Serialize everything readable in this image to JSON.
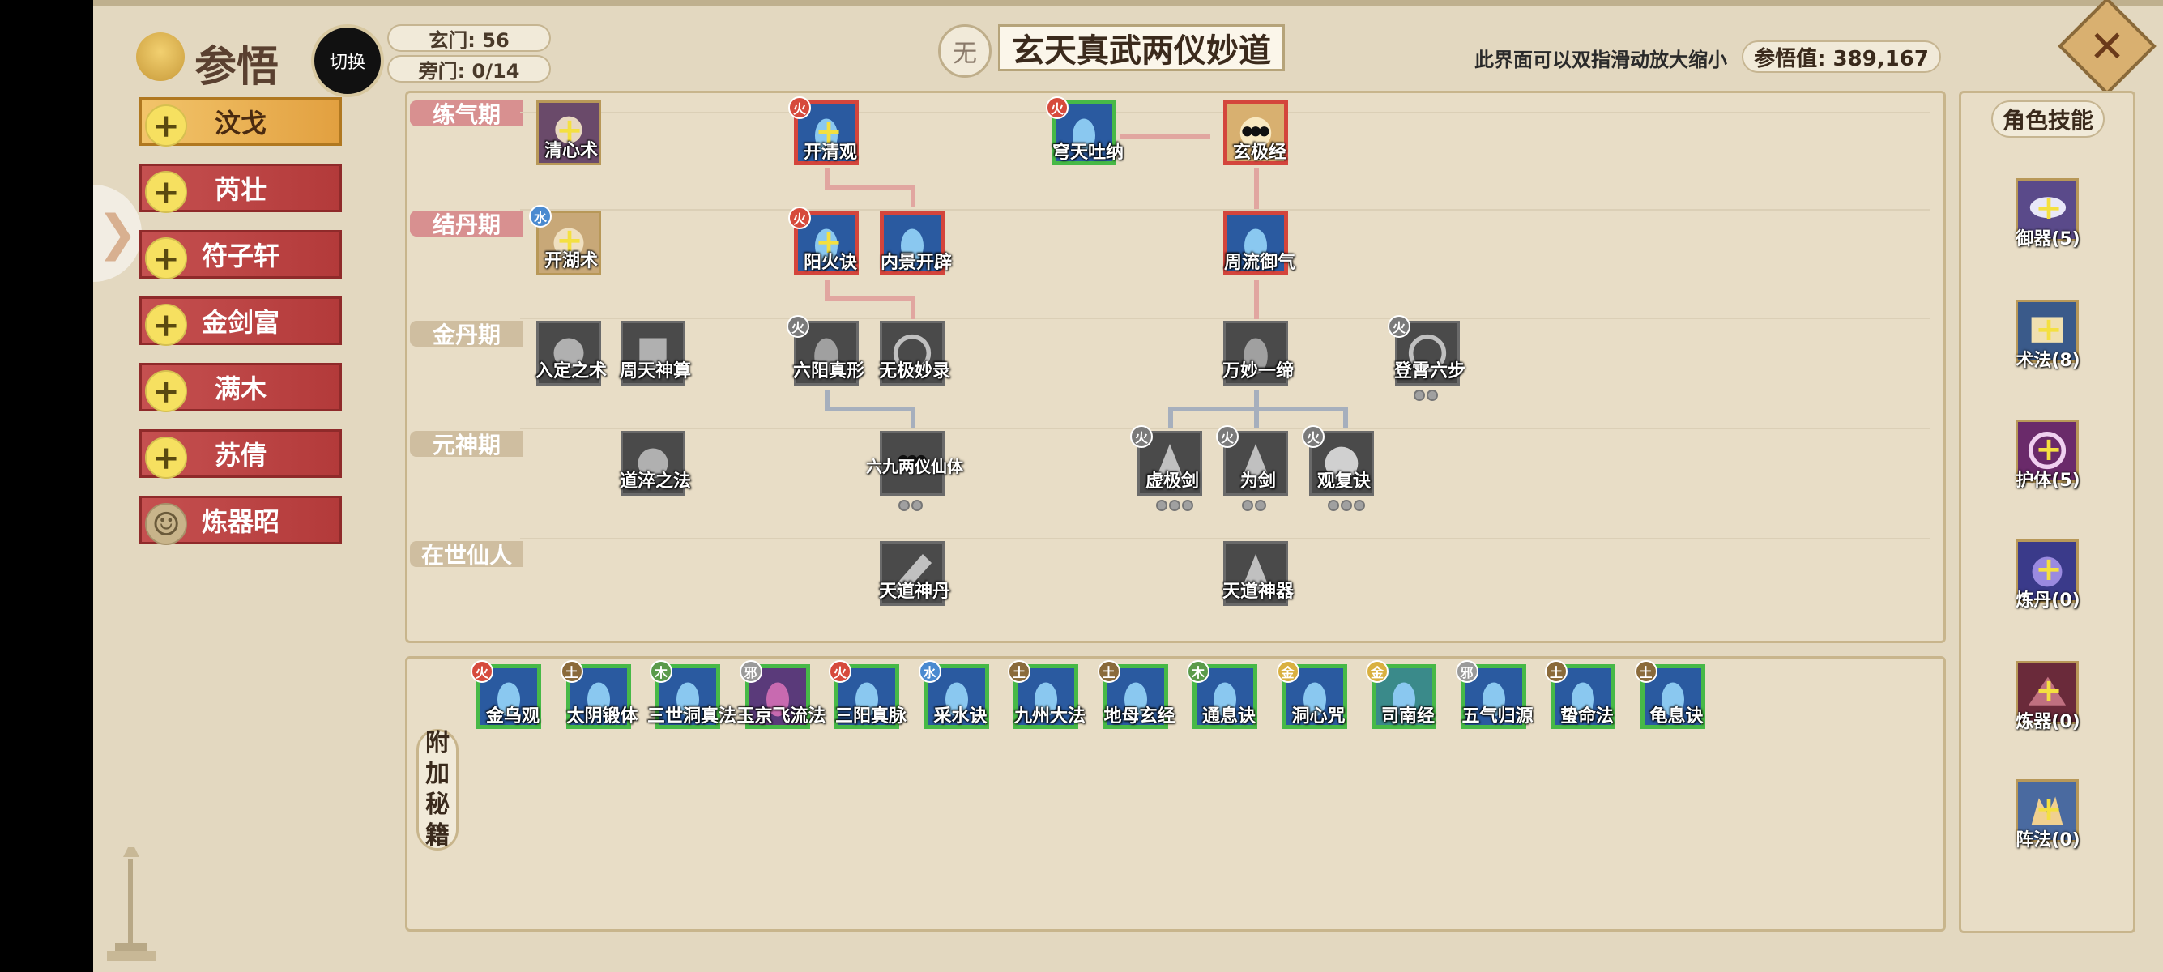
{
  "header": {
    "title": "参悟",
    "yin_label": "切换",
    "xuanmen": "玄门: 56",
    "pangmen": "旁门: 0/14",
    "wu_badge": "无",
    "section_title": "玄天真武两仪妙道",
    "hint": "此界面可以双指滑动放大缩小",
    "score": "参悟值: 389,167"
  },
  "sidebar": {
    "items": [
      {
        "label": "汶戈"
      },
      {
        "label": "芮壮"
      },
      {
        "label": "符子轩"
      },
      {
        "label": "金剑富"
      },
      {
        "label": "满木"
      },
      {
        "label": "苏倩"
      },
      {
        "label": "炼器昭"
      }
    ]
  },
  "stages": [
    {
      "label": "练气期"
    },
    {
      "label": "结丹期"
    },
    {
      "label": "金丹期"
    },
    {
      "label": "元神期"
    },
    {
      "label": "在世仙人"
    }
  ],
  "skills": [
    {
      "label": "清心术"
    },
    {
      "label": "开清观",
      "element": "火"
    },
    {
      "label": "穹天吐纳",
      "element": "火"
    },
    {
      "label": "玄极经"
    },
    {
      "label": "开湖术",
      "element": "水"
    },
    {
      "label": "阳火诀",
      "element": "火"
    },
    {
      "label": "内景开辟"
    },
    {
      "label": "周流御气"
    },
    {
      "label": "入定之术"
    },
    {
      "label": "周天神算"
    },
    {
      "label": "六阳真形",
      "element": "火"
    },
    {
      "label": "无极妙录"
    },
    {
      "label": "万妙一缔"
    },
    {
      "label": "登霄六步",
      "element": "火"
    },
    {
      "label": "道淬之法"
    },
    {
      "label": "六九两仪仙体"
    },
    {
      "label": "虚极剑",
      "element": "火"
    },
    {
      "label": "为剑",
      "element": "火"
    },
    {
      "label": "观复诀",
      "element": "火"
    },
    {
      "label": "天道神丹"
    },
    {
      "label": "天道神器"
    }
  ],
  "appendix": {
    "title_chars": [
      "附",
      "加",
      "秘",
      "籍"
    ],
    "items": [
      {
        "label": "金乌观",
        "element": "火"
      },
      {
        "label": "太阴锻体",
        "element": "土"
      },
      {
        "label": "三世洞真法",
        "element": "木"
      },
      {
        "label": "玉京飞流法",
        "element": "邪"
      },
      {
        "label": "三阳真脉",
        "element": "火"
      },
      {
        "label": "采水诀",
        "element": "水"
      },
      {
        "label": "九州大法",
        "element": "土"
      },
      {
        "label": "地母玄经",
        "element": "土"
      },
      {
        "label": "通息诀",
        "element": "木"
      },
      {
        "label": "洞心咒",
        "element": "金"
      },
      {
        "label": "司南经",
        "element": "金"
      },
      {
        "label": "五气归源",
        "element": "邪"
      },
      {
        "label": "蛰命法",
        "element": "土"
      },
      {
        "label": "龟息诀",
        "element": "土"
      }
    ]
  },
  "right_panel": {
    "title": "角色技能",
    "items": [
      {
        "label": "御器(5)"
      },
      {
        "label": "术法(8)"
      },
      {
        "label": "护体(5)"
      },
      {
        "label": "炼丹(0)"
      },
      {
        "label": "炼器(0)"
      },
      {
        "label": "阵法(0)"
      }
    ]
  },
  "colors": {
    "fire": "#d64a3c",
    "earth": "#8a6a3a",
    "wood": "#5a9a4a",
    "water": "#4a8ad0",
    "gold": "#d9b040",
    "evil": "#9a9a9a",
    "sidebar_red": "#b33a3a",
    "sidebar_active": "#e2a040"
  }
}
